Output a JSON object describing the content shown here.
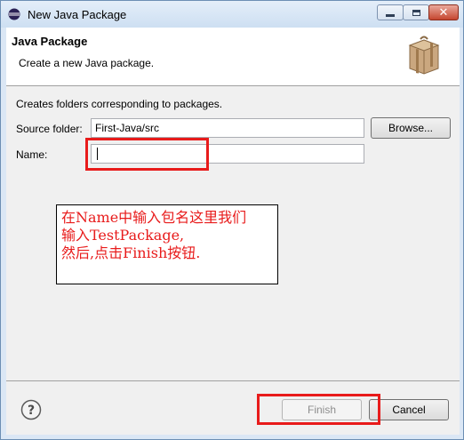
{
  "window": {
    "title": "New Java Package"
  },
  "banner": {
    "title": "Java Package",
    "description": "Create a new Java package."
  },
  "body": {
    "intro": "Creates folders corresponding to packages.",
    "source_folder_label": "Source folder:",
    "source_folder_value": "First-Java/src",
    "name_label": "Name:",
    "name_value": ""
  },
  "buttons": {
    "browse": "Browse...",
    "finish": "Finish",
    "cancel": "Cancel"
  },
  "annotation": {
    "line1": "在Name中输入包名这里我们",
    "line2": "输入TestPackage,",
    "line3": "然后,点击Finish按钮."
  },
  "colors": {
    "highlight": "#e81b1b",
    "titlebar": "#cddff2"
  }
}
